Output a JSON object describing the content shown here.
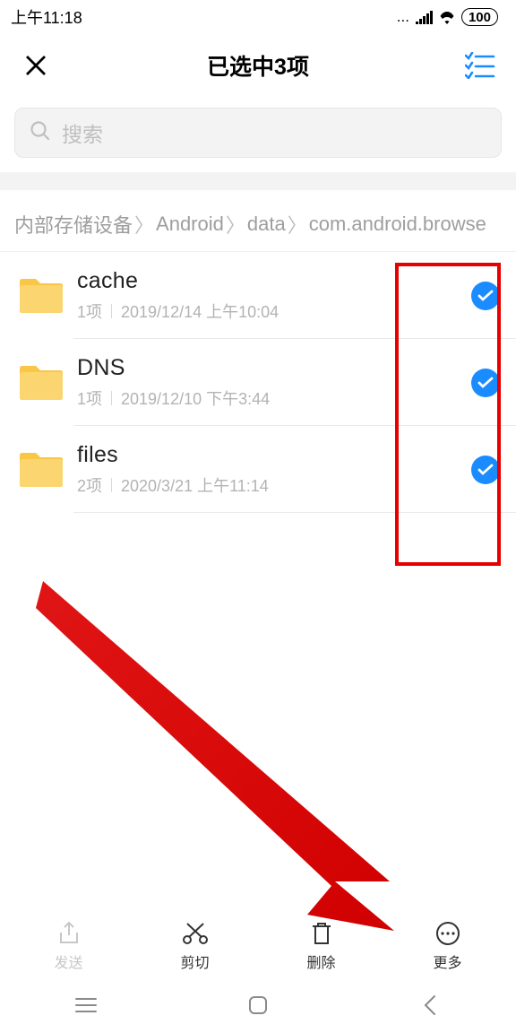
{
  "status": {
    "time": "上午11:18",
    "battery": "100"
  },
  "header": {
    "title": "已选中3项"
  },
  "search": {
    "placeholder": "搜索"
  },
  "breadcrumbs": [
    "内部存储设备",
    "Android",
    "data",
    "com.android.browse"
  ],
  "folders": [
    {
      "name": "cache",
      "count": "1项",
      "datetime": "2019/12/14 上午10:04",
      "selected": true
    },
    {
      "name": "DNS",
      "count": "1项",
      "datetime": "2019/12/10 下午3:44",
      "selected": true
    },
    {
      "name": "files",
      "count": "2项",
      "datetime": "2020/3/21 上午11:14",
      "selected": true
    }
  ],
  "actions": {
    "send": "发送",
    "cut": "剪切",
    "delete": "删除",
    "more": "更多"
  }
}
